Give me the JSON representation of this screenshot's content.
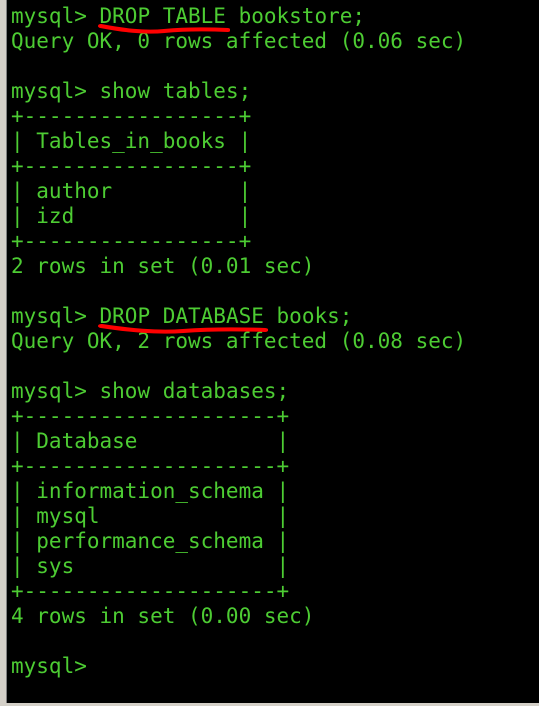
{
  "terminal": {
    "prompt": "mysql> ",
    "lines": [
      {
        "kind": "cmd",
        "pre": "",
        "highlight": "DROP TABLE",
        "post": " bookstore;"
      },
      {
        "kind": "out",
        "text": "Query OK, 0 rows affected (0.06 sec)"
      },
      {
        "kind": "blank",
        "text": ""
      },
      {
        "kind": "cmd",
        "pre": "",
        "highlight": "",
        "post": "show tables;"
      },
      {
        "kind": "out",
        "text": "+-----------------+"
      },
      {
        "kind": "out",
        "text": "| Tables_in_books |"
      },
      {
        "kind": "out",
        "text": "+-----------------+"
      },
      {
        "kind": "out",
        "text": "| author          |"
      },
      {
        "kind": "out",
        "text": "| izd             |"
      },
      {
        "kind": "out",
        "text": "+-----------------+"
      },
      {
        "kind": "out",
        "text": "2 rows in set (0.01 sec)"
      },
      {
        "kind": "blank",
        "text": ""
      },
      {
        "kind": "cmd",
        "pre": "",
        "highlight": "DROP DATABASE",
        "post": " books;"
      },
      {
        "kind": "out",
        "text": "Query OK, 2 rows affected (0.08 sec)"
      },
      {
        "kind": "blank",
        "text": ""
      },
      {
        "kind": "cmd",
        "pre": "",
        "highlight": "",
        "post": "show databases;"
      },
      {
        "kind": "out",
        "text": "+--------------------+"
      },
      {
        "kind": "out",
        "text": "| Database           |"
      },
      {
        "kind": "out",
        "text": "+--------------------+"
      },
      {
        "kind": "out",
        "text": "| information_schema |"
      },
      {
        "kind": "out",
        "text": "| mysql              |"
      },
      {
        "kind": "out",
        "text": "| performance_schema |"
      },
      {
        "kind": "out",
        "text": "| sys                |"
      },
      {
        "kind": "out",
        "text": "+--------------------+"
      },
      {
        "kind": "out",
        "text": "4 rows in set (0.00 sec)"
      },
      {
        "kind": "blank",
        "text": ""
      },
      {
        "kind": "cmd",
        "pre": "",
        "highlight": "",
        "post": ""
      }
    ]
  },
  "colors": {
    "background": "#000000",
    "text": "#4dcc33",
    "annotation": "#ff0000"
  }
}
